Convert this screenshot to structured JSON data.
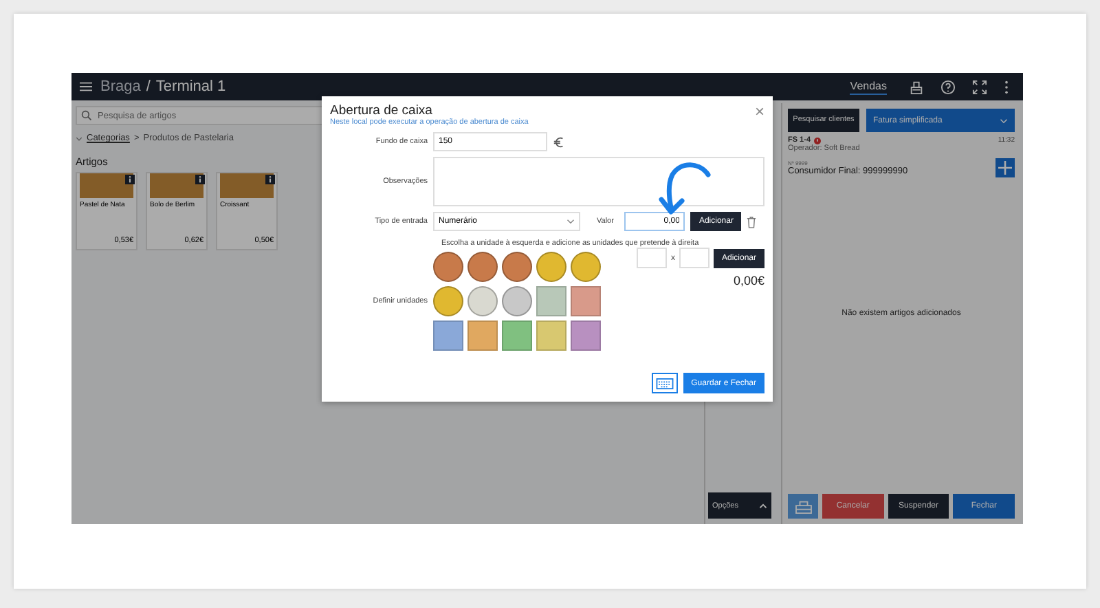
{
  "header": {
    "location": "Braga",
    "separator": "/",
    "terminal": "Terminal 1",
    "nav": [
      {
        "label": "Vendas",
        "selected": true
      }
    ]
  },
  "search": {
    "placeholder": "Pesquisa de artigos"
  },
  "breadcrumb": {
    "root": "Categorias",
    "separator": ">",
    "current": "Produtos de Pastelaria"
  },
  "articles": {
    "title": "Artigos",
    "items": [
      {
        "name": "Pastel de Nata",
        "price": "0,53€"
      },
      {
        "name": "Bolo de Berlim",
        "price": "0,62€"
      },
      {
        "name": "Croissant",
        "price": "0,50€"
      }
    ]
  },
  "options_button": "Opções",
  "sale": {
    "search_clients": "Pesquisar clientes",
    "doc_type": "Fatura simplificada",
    "doc_number": "FS 1-4",
    "time": "11:32",
    "operator": "Operador: Soft Bread",
    "client_number": "Nº 9999",
    "client": "Consumidor Final: 999999990",
    "empty": "Não existem artigos adicionados",
    "actions": [
      {
        "kind": "icon"
      },
      {
        "kind": "danger",
        "label": "Cancelar"
      },
      {
        "kind": "dark",
        "label": "Suspender"
      },
      {
        "kind": "primary",
        "label": "Fechar"
      }
    ]
  },
  "modal": {
    "title": "Abertura de caixa",
    "subtitle": "Neste local pode executar a operação de abertura de caixa",
    "close": "×",
    "fund_label": "Fundo de caixa",
    "fund_value": "150",
    "notes_label": "Observações",
    "entry_label": "Tipo de entrada",
    "entry_value": "Numerário",
    "value_label": "Valor",
    "value": "0,00",
    "add": "Adicionar",
    "hint": "Escolha a unidade à esquerda e adicione as unidades que pretende à direita",
    "units_label": "Definir unidades",
    "times": "x",
    "add_units": "Adicionar",
    "total": "0,00€",
    "save": "Guardar e Fechar",
    "units": [
      {
        "kind": "coin",
        "color": "#c87a4a"
      },
      {
        "kind": "coin",
        "color": "#c87a4a"
      },
      {
        "kind": "coin",
        "color": "#c87a4a"
      },
      {
        "kind": "coin",
        "color": "#e0b830"
      },
      {
        "kind": "coin",
        "color": "#e0b830"
      },
      {
        "kind": "coin",
        "color": "#e0b830"
      },
      {
        "kind": "coin",
        "color": "#d9d9d0"
      },
      {
        "kind": "coin",
        "color": "#c8c8c8"
      },
      {
        "kind": "note",
        "color": "#b8c8b8"
      },
      {
        "kind": "note",
        "color": "#d89a8a"
      },
      {
        "kind": "note",
        "color": "#8aa8d8"
      },
      {
        "kind": "note",
        "color": "#e0a860"
      },
      {
        "kind": "note",
        "color": "#80c080"
      },
      {
        "kind": "note",
        "color": "#d8c870"
      },
      {
        "kind": "note",
        "color": "#b890c0"
      }
    ]
  }
}
